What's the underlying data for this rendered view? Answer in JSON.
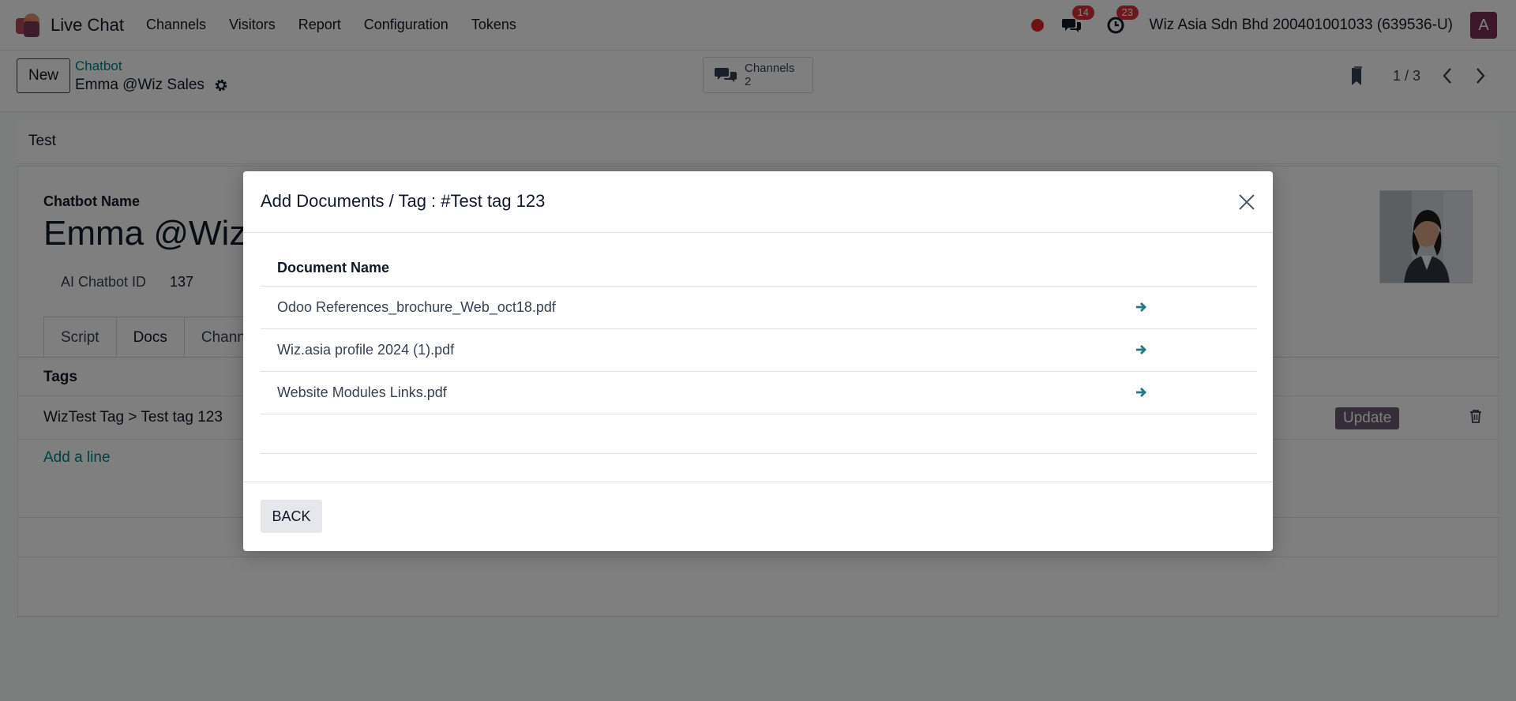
{
  "navbar": {
    "app_name": "Live Chat",
    "menu": [
      "Channels",
      "Visitors",
      "Report",
      "Configuration",
      "Tokens"
    ],
    "messages_count": "14",
    "activities_count": "23",
    "company": "Wiz Asia Sdn Bhd 200401001033 (639536-U)",
    "user_initial": "A",
    "status_color": "#dc2626"
  },
  "control_panel": {
    "new_label": "New",
    "breadcrumb_parent": "Chatbot",
    "breadcrumb_current": "Emma @Wiz Sales",
    "smart_button_label": "Channels",
    "smart_button_count": "2",
    "pager": "1 / 3"
  },
  "form": {
    "statusbar_label": "Test",
    "name_label": "Chatbot Name",
    "name_value": "Emma @Wiz",
    "id_label": "AI Chatbot ID",
    "id_value": "137",
    "tabs": [
      "Script",
      "Docs",
      "Chann"
    ],
    "active_tab": "Docs",
    "tags_header": "Tags",
    "tag_value": "WizTest Tag > Test tag 123",
    "update_label": "Update",
    "add_line_label": "Add a line"
  },
  "modal": {
    "title": "Add Documents / Tag : #Test tag 123",
    "column_header": "Document Name",
    "documents": [
      "Odoo References_brochure_Web_oct18.pdf",
      "Wiz.asia profile 2024 (1).pdf",
      "Website Modules Links.pdf"
    ],
    "back_label": "BACK"
  },
  "colors": {
    "accent": "#017e84",
    "brand": "#7b2f54",
    "badge": "#d6333a",
    "update_button": "#6b5a6e"
  }
}
